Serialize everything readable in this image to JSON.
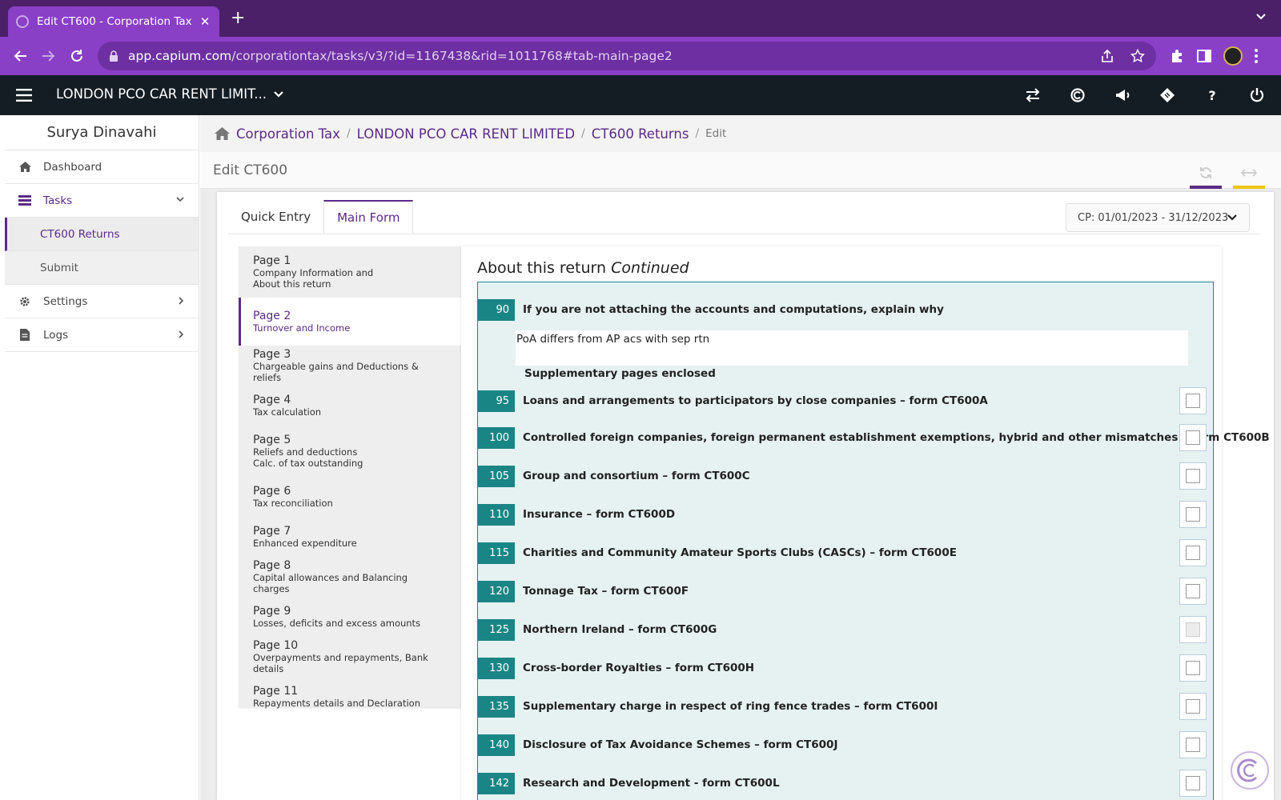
{
  "browser": {
    "tab_title": "Edit CT600 - Corporation Tax",
    "url_host": "app.capium.com",
    "url_path": "/corporationtax/tasks/v3/?id=1167438&rid=1011768#tab-main-page2"
  },
  "header": {
    "company": "LONDON PCO CAR RENT LIMIT..."
  },
  "sidebar": {
    "user": "Surya Dinavahi",
    "items": [
      {
        "label": "Dashboard"
      },
      {
        "label": "Tasks"
      },
      {
        "label": "CT600 Returns"
      },
      {
        "label": "Submit"
      },
      {
        "label": "Settings"
      },
      {
        "label": "Logs"
      }
    ]
  },
  "breadcrumb": {
    "items": [
      "Corporation Tax",
      "LONDON PCO CAR RENT LIMITED",
      "CT600 Returns"
    ],
    "current": "Edit"
  },
  "page_title": "Edit CT600",
  "form_tabs": [
    {
      "label": "Quick Entry"
    },
    {
      "label": "Main Form"
    }
  ],
  "period": "CP: 01/01/2023 - 31/12/2023",
  "pages": [
    {
      "title": "Page 1",
      "sub1": "Company Information and",
      "sub2": "About this return"
    },
    {
      "title": "Page 2",
      "sub1": "Turnover and Income",
      "sub2": ""
    },
    {
      "title": "Page 3",
      "sub1": "Chargeable gains and Deductions & reliefs",
      "sub2": ""
    },
    {
      "title": "Page 4",
      "sub1": "Tax calculation",
      "sub2": ""
    },
    {
      "title": "Page 5",
      "sub1": "Reliefs and deductions",
      "sub2": "Calc. of tax outstanding"
    },
    {
      "title": "Page 6",
      "sub1": "Tax reconciliation",
      "sub2": ""
    },
    {
      "title": "Page 7",
      "sub1": "Enhanced expenditure",
      "sub2": ""
    },
    {
      "title": "Page 8",
      "sub1": "Capital allowances and Balancing charges",
      "sub2": ""
    },
    {
      "title": "Page 9",
      "sub1": "Losses, deficits and excess amounts",
      "sub2": ""
    },
    {
      "title": "Page 10",
      "sub1": "Overpayments and repayments, Bank details",
      "sub2": ""
    },
    {
      "title": "Page 11",
      "sub1": "Repayments details and Declaration",
      "sub2": ""
    }
  ],
  "section": {
    "title": "About this return",
    "title_suffix": "Continued",
    "q90_num": "90",
    "q90_label": "If you are not attaching the accounts and computations, explain why",
    "q90_value": "PoA differs from AP acs with sep rtn",
    "supp_heading": "Supplementary pages enclosed",
    "rows": [
      {
        "num": "95",
        "label": "Loans and arrangements to participators by close companies – form CT600A"
      },
      {
        "num": "100",
        "label": "Controlled foreign companies, foreign permanent establishment exemptions, hybrid and other mismatches – form CT600B"
      },
      {
        "num": "105",
        "label": "Group and consortium – form CT600C"
      },
      {
        "num": "110",
        "label": "Insurance – form CT600D"
      },
      {
        "num": "115",
        "label": "Charities and Community Amateur Sports Clubs (CASCs) – form CT600E"
      },
      {
        "num": "120",
        "label": "Tonnage Tax – form CT600F"
      },
      {
        "num": "125",
        "label": "Northern Ireland – form CT600G"
      },
      {
        "num": "130",
        "label": "Cross-border Royalties – form CT600H"
      },
      {
        "num": "135",
        "label": "Supplementary charge in respect of ring fence trades – form CT600I"
      },
      {
        "num": "140",
        "label": "Disclosure of Tax Avoidance Schemes – form CT600J"
      },
      {
        "num": "142",
        "label": "Research and Development - form CT600L"
      }
    ]
  },
  "colors": {
    "brand": "#5b2a86",
    "teal": "#1a8585",
    "panel_bg": "#e6f2f2"
  }
}
